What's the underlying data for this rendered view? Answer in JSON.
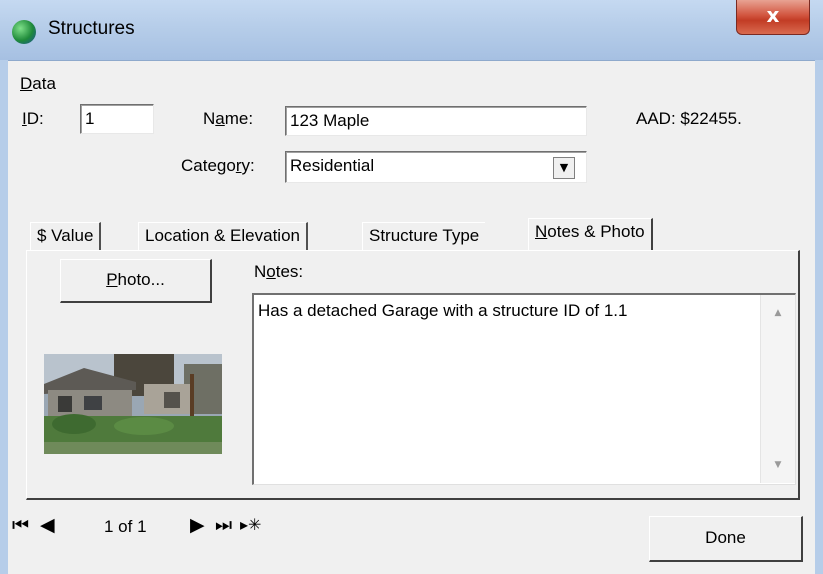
{
  "window": {
    "title": "Structures",
    "close_glyph": "x",
    "app_icon": "globe-icon"
  },
  "menu": {
    "items": [
      {
        "label": "Data",
        "accel": "D",
        "rest": "ata"
      }
    ]
  },
  "form": {
    "id_label": {
      "accel": "I",
      "rest": "D:"
    },
    "id_value": "1",
    "name_label": {
      "pre": "N",
      "accel": "a",
      "rest": "me:"
    },
    "name_value": "123 Maple",
    "aad_text": "AAD: $22455.",
    "category_label": {
      "pre": "Catego",
      "accel": "r",
      "rest": "y:"
    },
    "category_value": "Residential"
  },
  "tabs": [
    {
      "label": "$ Value"
    },
    {
      "label": "Location & Elevation"
    },
    {
      "label": "Structure Type"
    },
    {
      "label": "Notes & Photo",
      "accel": "N",
      "rest": "otes & Photo",
      "active": true
    }
  ],
  "panel": {
    "photo_button": {
      "accel": "P",
      "rest": "hoto..."
    },
    "notes_label": {
      "pre": "N",
      "accel": "o",
      "rest": "tes:"
    },
    "notes_text": "Has a detached Garage with a structure ID of 1.1",
    "photo_image": "house-photo"
  },
  "navigator": {
    "record_text": "1 of 1"
  },
  "done_button": "Done",
  "colors": {
    "titlebar": "#b6cde9",
    "close": "#c23c25",
    "background": "#f0f0f0"
  }
}
